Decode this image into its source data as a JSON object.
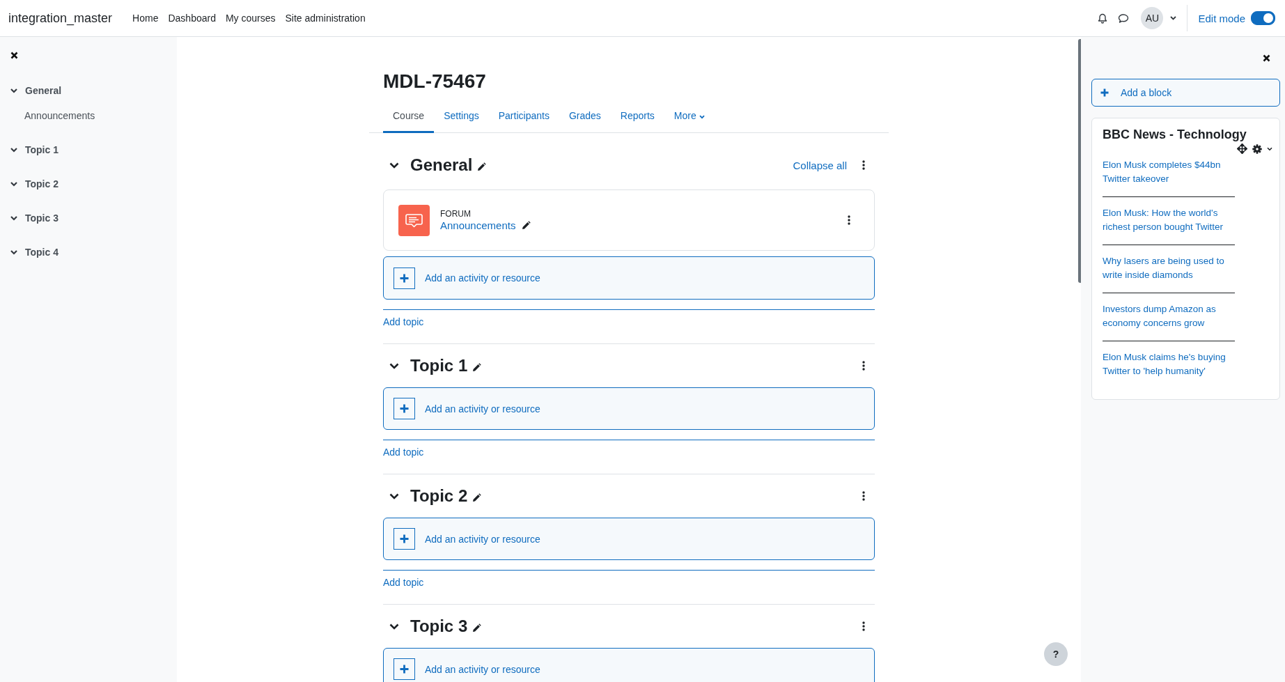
{
  "header": {
    "site_name": "integration_master",
    "nav": [
      {
        "label": "Home"
      },
      {
        "label": "Dashboard"
      },
      {
        "label": "My courses"
      },
      {
        "label": "Site administration"
      }
    ],
    "avatar": "AU",
    "edit_mode": {
      "label": "Edit mode",
      "on": true
    }
  },
  "course_index": {
    "items": [
      {
        "label": "General",
        "expanded": true,
        "children": [
          {
            "label": "Announcements"
          }
        ]
      },
      {
        "label": "Topic 1",
        "expanded": true
      },
      {
        "label": "Topic 2",
        "expanded": true
      },
      {
        "label": "Topic 3",
        "expanded": true
      },
      {
        "label": "Topic 4",
        "expanded": true
      }
    ]
  },
  "course": {
    "title": "MDL-75467",
    "tabs": [
      {
        "label": "Course",
        "selected": true,
        "kind": "link"
      },
      {
        "label": "Settings",
        "selected": false,
        "kind": "link"
      },
      {
        "label": "Participants",
        "selected": false,
        "kind": "link"
      },
      {
        "label": "Grades",
        "selected": false,
        "kind": "link"
      },
      {
        "label": "Reports",
        "selected": false,
        "kind": "link"
      },
      {
        "label": "More",
        "selected": false,
        "kind": "dropdown"
      }
    ],
    "collapse_all": "Collapse all",
    "sections": [
      {
        "title": "General",
        "expanded": true,
        "activities": [
          {
            "type": "FORUM",
            "name": "Announcements"
          }
        ],
        "add_activity": "Add an activity or resource",
        "add_topic": "Add topic"
      },
      {
        "title": "Topic 1",
        "expanded": true,
        "add_activity": "Add an activity or resource",
        "add_topic": "Add topic"
      },
      {
        "title": "Topic 2",
        "expanded": true,
        "add_activity": "Add an activity or resource",
        "add_topic": "Add topic"
      },
      {
        "title": "Topic 3",
        "expanded": true,
        "add_activity": "Add an activity or resource"
      }
    ]
  },
  "blocks_drawer": {
    "add_block": "Add a block",
    "block": {
      "title": "BBC News - Technology",
      "items": [
        {
          "label": "Elon Musk completes $44bn Twitter takeover"
        },
        {
          "label": "Elon Musk: How the world's richest person bought Twitter"
        },
        {
          "label": "Why lasers are being used to write inside diamonds"
        },
        {
          "label": "Investors dump Amazon as economy concerns grow"
        },
        {
          "label": "Elon Musk claims he's buying Twitter to 'help humanity'"
        }
      ]
    }
  },
  "help_button": "?"
}
